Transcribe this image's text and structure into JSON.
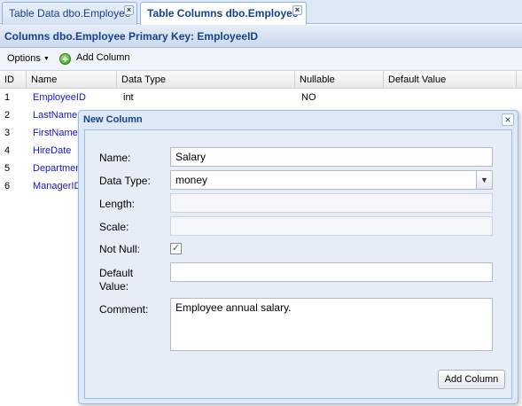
{
  "tabs": [
    {
      "label": "Table Data dbo.Employee",
      "active": false
    },
    {
      "label": "Table Columns dbo.Employee",
      "active": true
    }
  ],
  "panel": {
    "title": "Columns dbo.Employee Primary Key: EmployeeID"
  },
  "toolbar": {
    "options_label": "Options",
    "add_column_label": "Add Column"
  },
  "grid": {
    "columns": [
      "ID",
      "Name",
      "Data Type",
      "Nullable",
      "Default Value"
    ],
    "rows": [
      {
        "id": "1",
        "name": "EmployeeID",
        "data_type": "int",
        "nullable": "NO",
        "default": ""
      },
      {
        "id": "2",
        "name": "LastName"
      },
      {
        "id": "3",
        "name": "FirstName"
      },
      {
        "id": "4",
        "name": "HireDate"
      },
      {
        "id": "5",
        "name": "Department"
      },
      {
        "id": "6",
        "name": "ManagerID"
      }
    ]
  },
  "dialog": {
    "title": "New Column",
    "name_label": "Name:",
    "name_value": "Salary",
    "data_type_label": "Data Type:",
    "data_type_value": "money",
    "length_label": "Length:",
    "scale_label": "Scale:",
    "not_null_label": "Not Null:",
    "not_null_checked": true,
    "default_label_line1": "Default",
    "default_label_line2": "Value:",
    "comment_label": "Comment:",
    "comment_value": "Employee annual salary.",
    "submit_label": "Add Column"
  },
  "colors": {
    "link": "#1515c8",
    "header_text": "#15428b",
    "panel_bg": "#dfe8f6"
  }
}
